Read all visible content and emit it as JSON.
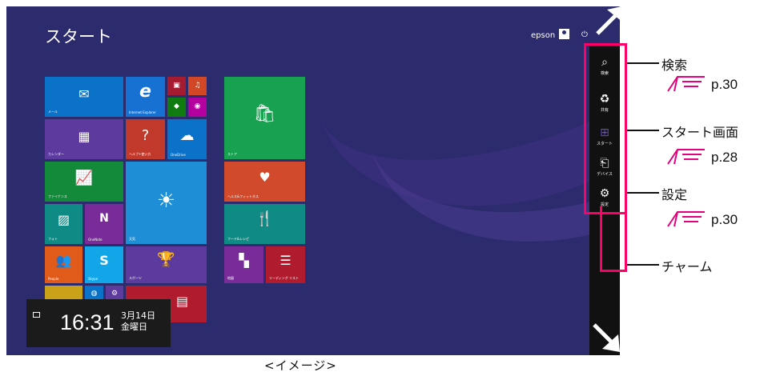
{
  "screen": {
    "title": "スタート",
    "user_name": "epson",
    "power_icon": "power-icon"
  },
  "tiles": {
    "mail": "メール",
    "ie": "Internet Explorer",
    "calendar": "カレンダー",
    "help": "ヘルプ+使い方",
    "onedrive": "OneDrive",
    "store": "ストア",
    "finance": "ファイナンス",
    "weather": "天気",
    "health": "ヘルス&フィットネス",
    "photos": "フォト",
    "onenote": "OneNote",
    "food": "フード&レシピ",
    "people": "People",
    "skype": "Skype",
    "sports": "スポーツ",
    "maps": "地図",
    "reading": "リーディング リスト"
  },
  "charms": {
    "search": "検索",
    "share": "共有",
    "start": "スタート",
    "devices": "デバイス",
    "settings": "設定"
  },
  "clock": {
    "time": "16:31",
    "date": "3月14日",
    "day": "金曜日"
  },
  "annotations": {
    "search_label": "検索",
    "search_page": "p.30",
    "start_label": "スタート画面",
    "start_page": "p.28",
    "settings_label": "設定",
    "settings_page": "p.30",
    "charm_label": "チャーム"
  },
  "caption": "<イメージ>",
  "colors": {
    "background": "#2b2b6e",
    "highlight": "#ff0066"
  }
}
